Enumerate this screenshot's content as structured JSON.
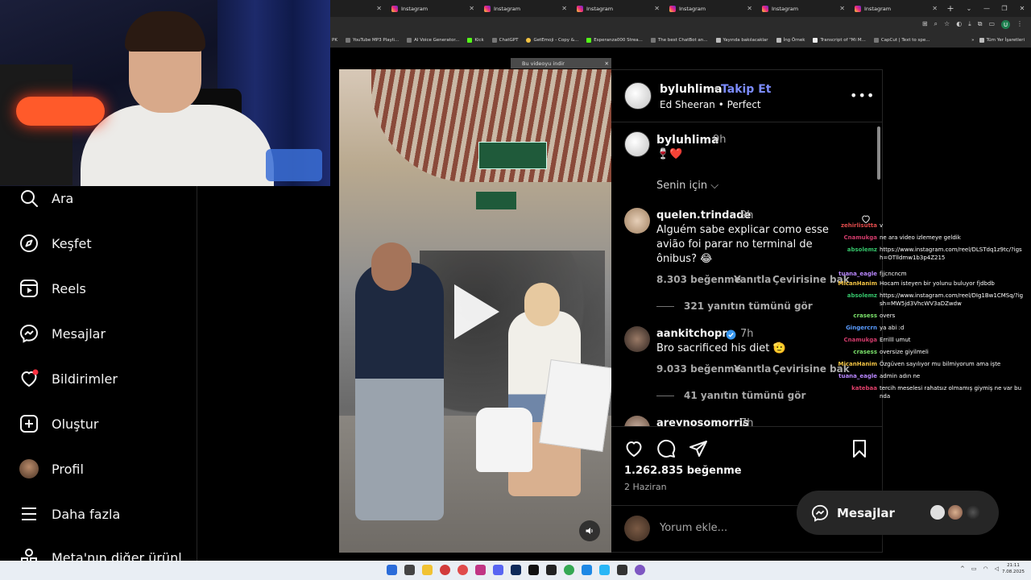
{
  "browser": {
    "tabs": [
      {
        "label": "",
        "active": false
      },
      {
        "label": "Instagram",
        "active": false
      },
      {
        "label": "Instagram",
        "active": false
      },
      {
        "label": "Instagram",
        "active": true
      },
      {
        "label": "Instagram",
        "active": false
      },
      {
        "label": "Instagram",
        "active": false
      },
      {
        "label": "Instagram",
        "active": false
      }
    ],
    "new_tab": "+",
    "profile_initial": "U",
    "bookmarks": [
      "PK",
      "YouTube MP3 Playli...",
      "AI Voice Generator...",
      "Kick",
      "ChatGPT",
      "GetEmoji - Copy &...",
      "Esperanza000 Strea...",
      "The best ChatBot an...",
      "Yayında bakılacaklar",
      "İng Örnek",
      "Transcript of \"Mi M...",
      "CapCut | Text to spe..."
    ],
    "bookmarks_more": "»",
    "all_bookmarks": "Tüm Yer İşaretleri"
  },
  "download_banner": "Bu videoyu indir",
  "sidebar": {
    "items": [
      {
        "label": "Ara",
        "icon": "search-icon"
      },
      {
        "label": "Keşfet",
        "icon": "compass-icon"
      },
      {
        "label": "Reels",
        "icon": "reels-icon"
      },
      {
        "label": "Mesajlar",
        "icon": "messenger-icon"
      },
      {
        "label": "Bildirimler",
        "icon": "heart-icon"
      },
      {
        "label": "Oluştur",
        "icon": "plus-square-icon"
      },
      {
        "label": "Profil",
        "icon": "avatar"
      },
      {
        "label": "Daha fazla",
        "icon": "menu-icon"
      },
      {
        "label": "Meta'nın diğer ürünl",
        "icon": "meta-apps-icon"
      }
    ]
  },
  "post": {
    "username": "byluhlima",
    "separator": "•",
    "follow_label": "Takip Et",
    "song": "Ed Sheeran • Perfect",
    "caption": {
      "username": "byluhlima",
      "time": "9h",
      "text": "🍷❤️"
    },
    "for_you": "Senin için ⌵",
    "comments": [
      {
        "username": "quelen.trindade",
        "time": "9h",
        "text": "Alguém sabe explicar como esse avião foi parar no terminal de ônibus? 😂",
        "likes": "8.303 beğenme",
        "reply": "Yanıtla",
        "translate": "Çevirisine bak",
        "replies": "321 yanıtın tümünü gör"
      },
      {
        "username": "aankitchopra",
        "time": "7h",
        "text": "Bro sacrificed his diet 🫡",
        "likes": "9.033 beğenme",
        "reply": "Yanıtla",
        "translate": "Çevirisine bak",
        "replies": "41 yanıtın tümünü gör"
      },
      {
        "username": "areynosomorris",
        "time": "7h"
      }
    ],
    "likes": "1.262.835 beğenme",
    "date": "2 Haziran",
    "comment_placeholder": "Yorum ekle..."
  },
  "chat": [
    {
      "name": "zehirlisutta",
      "color": "#e04b4b",
      "msg": "v"
    },
    {
      "name": "Cnamukga",
      "color": "#d23b6b",
      "msg": "ne ara video izlemeye geldik"
    },
    {
      "name": "absolemz",
      "color": "#35c46a",
      "msg": "https://www.instagram.com/reel/DLSTdq1z9tc/?igsh=OTlldmw1b3p4Z215"
    },
    {
      "name": "tuana_eagle",
      "color": "#b987ff",
      "msg": "fjjcncncm"
    },
    {
      "name": "MicanHanim",
      "color": "#f3c343",
      "msg": "Hocam isteyen bir yolunu buluyor fjdbdb"
    },
    {
      "name": "absolemz",
      "color": "#35c46a",
      "msg": "https://www.instagram.com/reel/DIg1Bw1CMSq/?igsh=MW5jd3VhcWV3aDZwdw"
    },
    {
      "name": "crasess",
      "color": "#7be26b",
      "msg": "overs"
    },
    {
      "name": "Gingercrn",
      "color": "#5a9cff",
      "msg": "ya abi :d"
    },
    {
      "name": "Cnamukga",
      "color": "#d23b6b",
      "msg": "Errilll umut"
    },
    {
      "name": "crasess",
      "color": "#7be26b",
      "msg": "oversize giyilmeli"
    },
    {
      "name": "MicanHanim",
      "color": "#f3c343",
      "msg": "Özgüven sayılıyor mu bilmiyorum ama işte"
    },
    {
      "name": "tuana_eagle",
      "color": "#b987ff",
      "msg": "admin adın ne"
    },
    {
      "name": "katebaa",
      "color": "#e0406a",
      "msg": "tercih meselesi rahatsız olmamış giymiş ne var bunda"
    }
  ],
  "messages_pill": {
    "label": "Mesajlar"
  },
  "taskbar": {
    "time": "21:11",
    "date": "7.08.2025"
  },
  "colors": {
    "follow_blue": "#7c8cff",
    "notification_red": "#ff3040",
    "background": "#000000"
  }
}
